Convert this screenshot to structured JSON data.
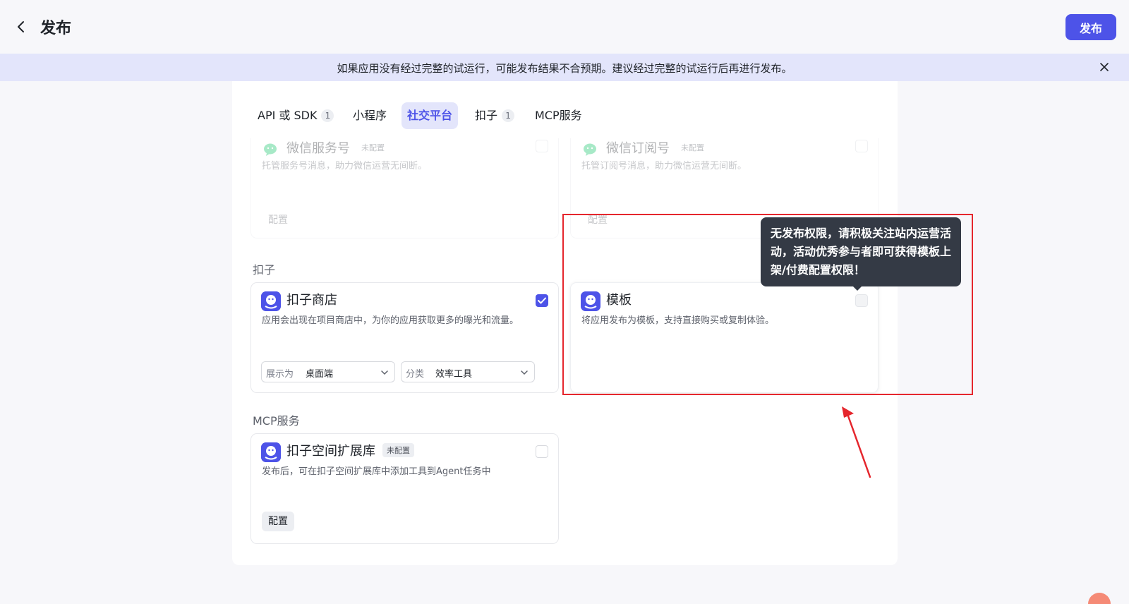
{
  "header": {
    "title": "发布",
    "publish_label": "发布"
  },
  "banner": {
    "text": "如果应用没有经过完整的试运行，可能发布结果不合预期。建议经过完整的试运行后再进行发布。"
  },
  "tabs": [
    {
      "label": "API 或 SDK",
      "count": "1"
    },
    {
      "label": "小程序"
    },
    {
      "label": "社交平台",
      "active": true
    },
    {
      "label": "扣子",
      "count": "1"
    },
    {
      "label": "MCP服务"
    }
  ],
  "wechat_service": {
    "title": "微信服务号",
    "badge": "未配置",
    "desc": "托管服务号消息，助力微信运营无间断。",
    "config_label": "配置"
  },
  "wechat_subscription": {
    "title": "微信订阅号",
    "badge": "未配置",
    "desc": "托管订阅号消息，助力微信运营无间断。",
    "config_label": "配置"
  },
  "sections": {
    "kouzi": "扣子",
    "mcp": "MCP服务"
  },
  "store_card": {
    "title": "扣子商店",
    "desc": "应用会出现在项目商店中，为你的应用获取更多的曝光和流量。",
    "display_label": "展示为",
    "display_value": "桌面端",
    "category_label": "分类",
    "category_value": "效率工具",
    "checked": true
  },
  "template_card": {
    "title": "模板",
    "desc": "将应用发布为模板，支持直接购买或复制体验。"
  },
  "tooltip": {
    "text": "无发布权限，请积极关注站内运营活动，活动优秀参与者即可获得模板上架/付费配置权限！"
  },
  "mcp_card": {
    "title": "扣子空间扩展库",
    "badge": "未配置",
    "desc": "发布后，可在扣子空间扩展库中添加工具到Agent任务中",
    "config_label": "配置"
  },
  "colors": {
    "accent": "#4d53e8",
    "banner_bg": "#e3e5fb",
    "annotation": "#e5262d",
    "tooltip_bg": "#343a45",
    "wechat_green": "#07c160"
  }
}
